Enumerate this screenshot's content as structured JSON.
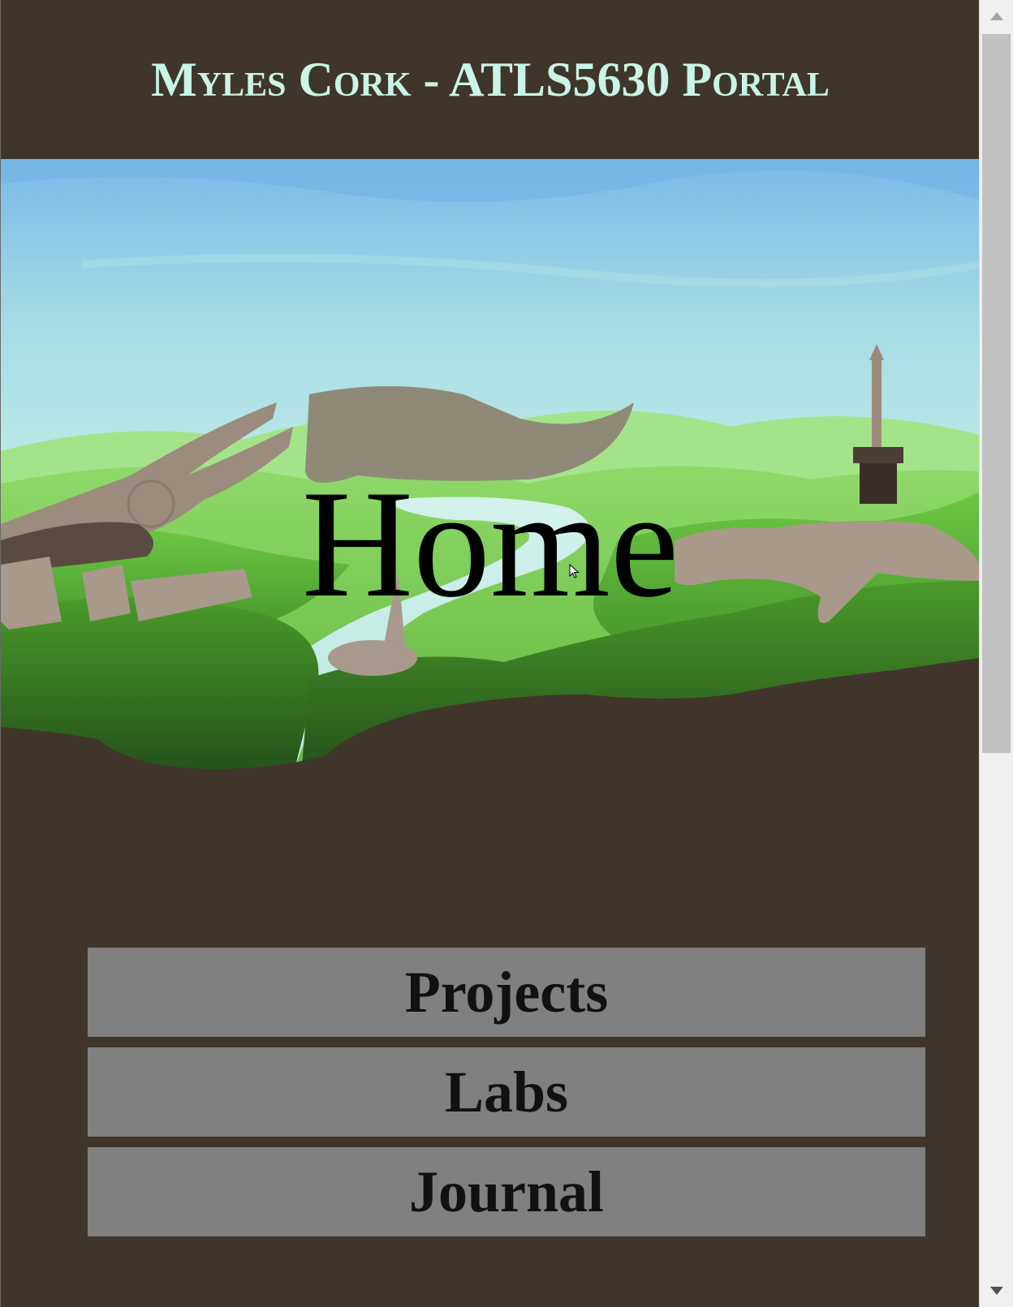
{
  "header": {
    "title": "Myles Cork - ATLS5630 Portal"
  },
  "hero": {
    "heading": "Home",
    "image_description_icon": "landscape-ruins-illustration"
  },
  "nav": {
    "items": [
      {
        "label": "Projects"
      },
      {
        "label": "Labs"
      },
      {
        "label": "Journal"
      }
    ]
  },
  "colors": {
    "page_background": "#40352b",
    "title_color": "#c8f5e6",
    "button_background": "#808080",
    "button_text": "#111111"
  },
  "scrollbar": {
    "up_icon": "triangle-up-icon",
    "down_icon": "triangle-down-icon"
  }
}
